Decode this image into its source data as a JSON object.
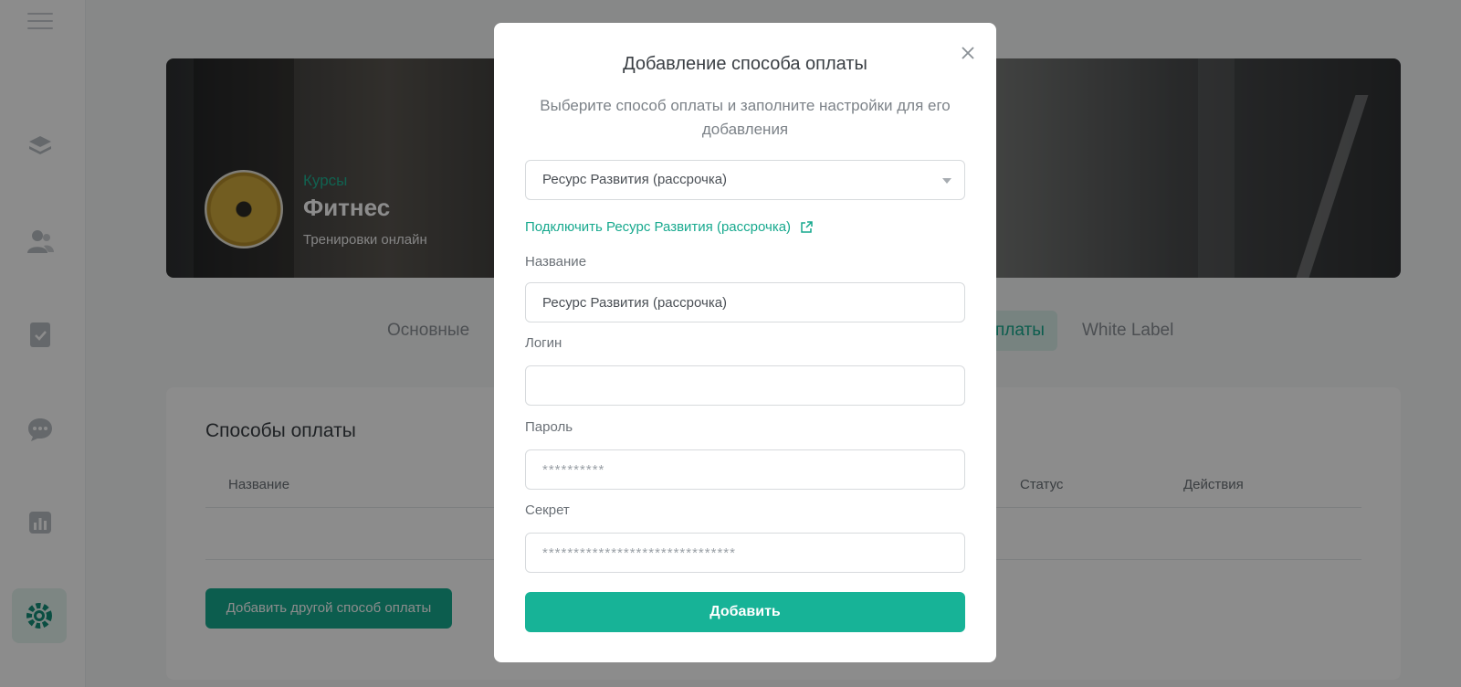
{
  "sidebar": {
    "icons": [
      "menu-icon",
      "layers-icon",
      "users-icon",
      "document-check-icon",
      "chat-icon",
      "chart-icon",
      "settings-gear-icon"
    ]
  },
  "banner": {
    "course_label": "Курсы",
    "title": "Фитнес",
    "subtitle": "Тренировки онлайн"
  },
  "tabs": [
    {
      "label": "Основные"
    },
    {
      "label": "платы"
    },
    {
      "label": "White Label"
    }
  ],
  "payments": {
    "title": "Способы оплаты",
    "columns": [
      "Название",
      "Статус",
      "Действия"
    ],
    "add_other_button": "Добавить другой способ оплаты"
  },
  "modal": {
    "title": "Добавление способа оплаты",
    "description": "Выберите способ оплаты и заполните настройки для его добавления",
    "selected_method": "Ресурс Развития (рассрочка)",
    "connect_link": "Подключить Ресурс Развития (рассрочка)",
    "fields": {
      "name_label": "Название",
      "name_value": "Ресурс Развития (рассрочка)",
      "login_label": "Логин",
      "login_value": "",
      "password_label": "Пароль",
      "password_placeholder": "**********",
      "secret_label": "Секрет",
      "secret_placeholder": "*******************************"
    },
    "submit_button": "Добавить"
  },
  "colors": {
    "accent": "#17b397",
    "accent_soft": "#d9efe9",
    "overlay": "rgba(0,0,0,0.45)"
  }
}
